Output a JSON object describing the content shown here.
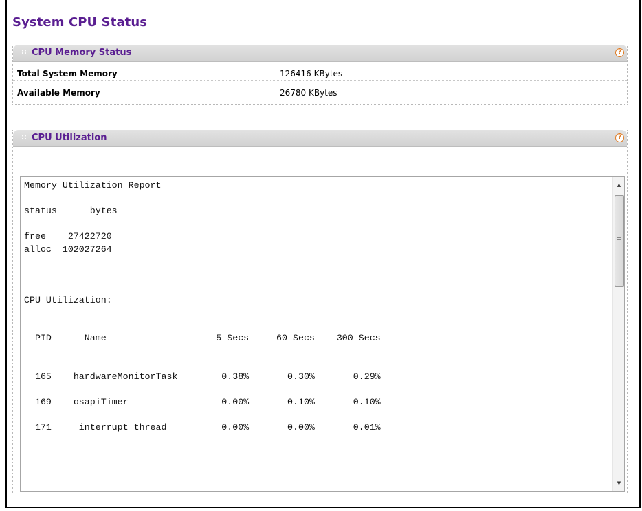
{
  "page": {
    "title": "System CPU Status"
  },
  "memory_status": {
    "header": "CPU Memory Status",
    "help_glyph": "?",
    "rows": [
      {
        "label": "Total System Memory",
        "value": "126416 KBytes"
      },
      {
        "label": "Available Memory",
        "value": "26780 KBytes"
      }
    ]
  },
  "cpu_utilization": {
    "header": "CPU Utilization",
    "help_glyph": "?",
    "report_text": "Memory Utilization Report\n\nstatus      bytes\n------ ----------\nfree    27422720\nalloc  102027264\n\n\n\nCPU Utilization:\n\n\n  PID      Name                    5 Secs     60 Secs    300 Secs\n-----------------------------------------------------------------\n\n  165    hardwareMonitorTask        0.38%       0.30%       0.29%\n\n  169    osapiTimer                 0.00%       0.10%       0.10%\n\n  171    _interrupt_thread          0.00%       0.00%       0.01%"
  },
  "colors": {
    "title": "#5a1e91",
    "header_bg": "#d9d9d9",
    "help_icon": "#e07a20"
  },
  "icons": {
    "help": "help-icon",
    "scroll_up": "scroll-up-arrow-icon",
    "scroll_down": "scroll-down-arrow-icon"
  }
}
